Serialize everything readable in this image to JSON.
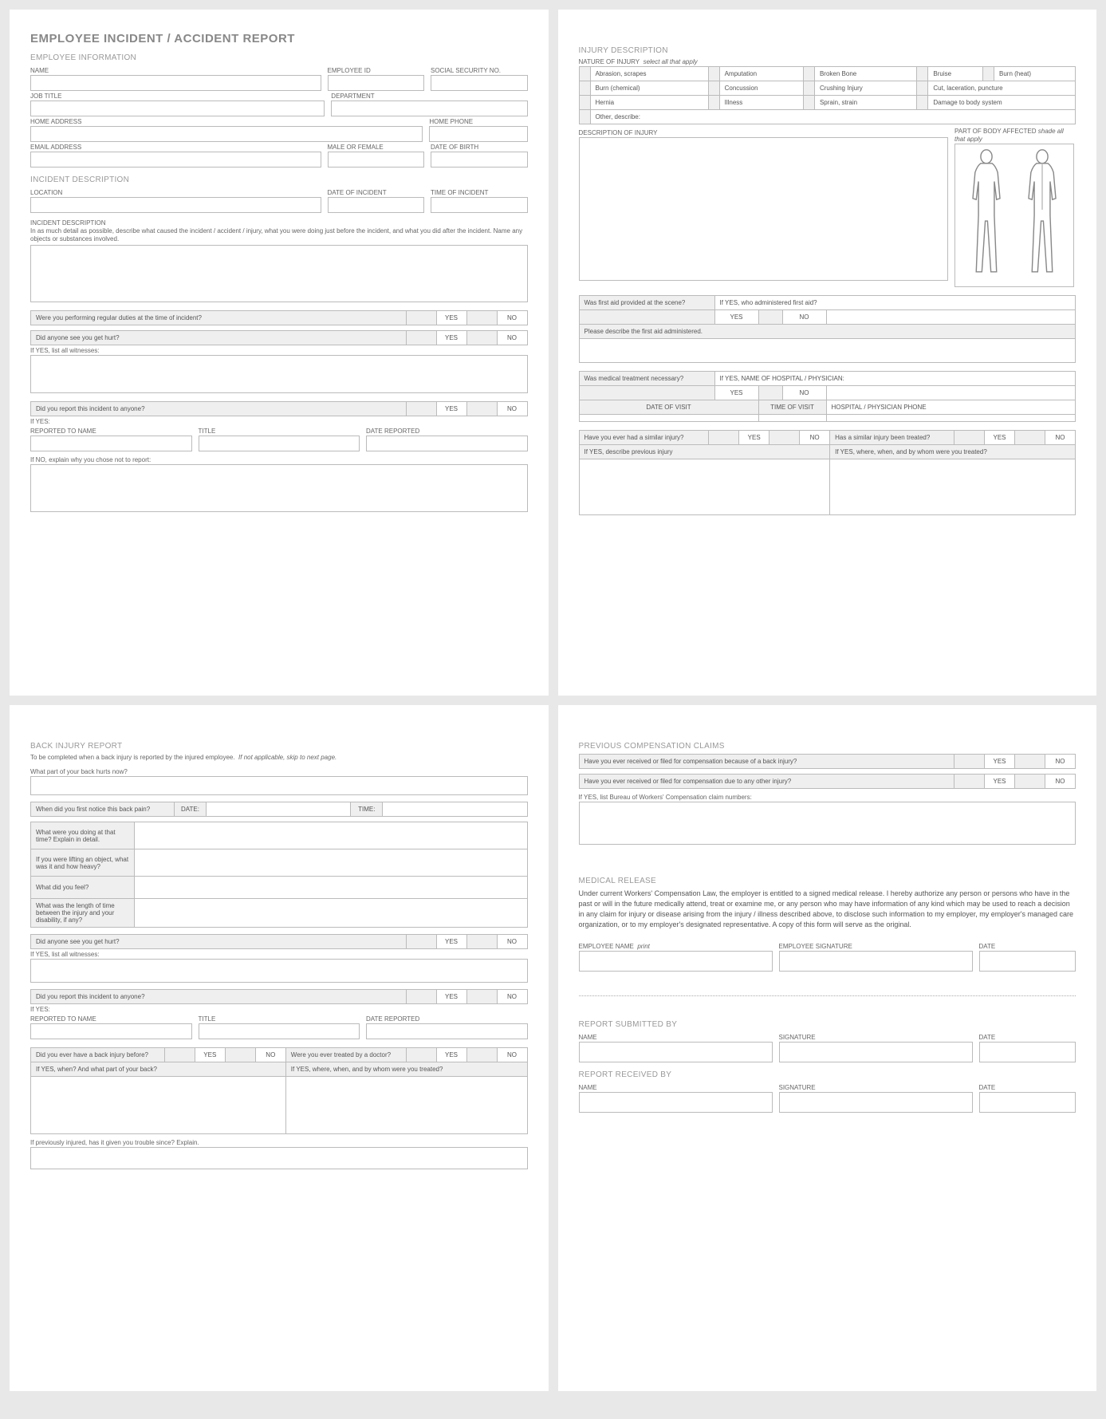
{
  "title": "EMPLOYEE INCIDENT / ACCIDENT REPORT",
  "p1": {
    "h_emp": "EMPLOYEE INFORMATION",
    "name": "NAME",
    "empid": "EMPLOYEE ID",
    "ssn": "SOCIAL SECURITY NO.",
    "job": "JOB TITLE",
    "dept": "DEPARTMENT",
    "home_addr": "HOME ADDRESS",
    "home_phone": "HOME PHONE",
    "email": "EMAIL ADDRESS",
    "mf": "MALE OR FEMALE",
    "dob": "DATE OF BIRTH",
    "h_inc": "INCIDENT DESCRIPTION",
    "loc": "LOCATION",
    "doi": "DATE OF INCIDENT",
    "toi": "TIME OF INCIDENT",
    "inc_desc_lbl": "INCIDENT DESCRIPTION",
    "inc_desc_txt": "In as much detail as possible, describe what caused the incident / accident / injury, what you were doing just before the incident, and what you did after the incident.  Name any objects or substances involved.",
    "q_duties": "Were you performing regular duties at the time of incident?",
    "q_seen": "Did anyone see you get hurt?",
    "witness": "If YES, list all witnesses:",
    "q_report": "Did you report this incident to anyone?",
    "if_yes": "If YES:",
    "rep_name": "REPORTED TO NAME",
    "rep_title": "TITLE",
    "rep_date": "DATE REPORTED",
    "if_no": "If NO, explain why you chose not to report:",
    "yes": "YES",
    "no": "NO"
  },
  "p2": {
    "h_inj": "INJURY DESCRIPTION",
    "nature_lbl": "NATURE OF INJURY",
    "nature_note": "select all that apply",
    "r1": [
      "Abrasion, scrapes",
      "Amputation",
      "Broken Bone",
      "Bruise",
      "Burn (heat)"
    ],
    "r2": [
      "Burn (chemical)",
      "Concussion",
      "Crushing Injury",
      "Cut, laceration, puncture"
    ],
    "r3": [
      "Hernia",
      "Illness",
      "Sprain, strain",
      "Damage to body system"
    ],
    "r4": "Other, describe:",
    "desc_inj": "DESCRIPTION OF INJURY",
    "body_aff": "PART OF BODY AFFECTED",
    "shade": "shade all that apply",
    "q_fa": "Was first aid provided at the scene?",
    "fa_who": "If YES, who administered first aid?",
    "fa_desc": "Please describe the first aid administered.",
    "q_med": "Was medical treatment necessary?",
    "med_name": "If YES, NAME OF HOSPITAL / PHYSICIAN:",
    "dov": "DATE OF VISIT",
    "tov": "TIME OF VISIT",
    "hp_phone": "HOSPITAL / PHYSICIAN PHONE",
    "q_sim": "Have you ever had a similar injury?",
    "q_sim_tr": "Has a similar injury been treated?",
    "sim_prev": "If YES, describe previous injury",
    "sim_where": "If YES, where, when, and by whom were you treated?",
    "yes": "YES",
    "no": "NO"
  },
  "p3": {
    "h_back": "BACK INJURY REPORT",
    "sub": "To be completed when a back injury is reported by the injured employee.",
    "sub_it": "If not applicable, skip to next page.",
    "q_part": "What part of your back hurts now?",
    "q_notice": "When did you first notice this back pain?",
    "date": "DATE:",
    "time": "TIME:",
    "q_doing": "What were you doing at that time?  Explain in detail.",
    "q_lift": "If you were lifting an object, what was it and how heavy?",
    "q_feel": "What did you feel?",
    "q_len": "What was the length of time between the injury and your disability, if any?",
    "q_seen": "Did anyone see you get hurt?",
    "witness": "If YES, list all witnesses:",
    "q_report": "Did you report this incident to anyone?",
    "if_yes": "If YES:",
    "rep_name": "REPORTED TO NAME",
    "rep_title": "TITLE",
    "rep_date": "DATE REPORTED",
    "q_prev_back": "Did you ever have a back injury before?",
    "q_prev_dr": "Were you ever treated by a doctor?",
    "prev_when": "If YES, when? And what part of your back?",
    "prev_where": "If YES, where, when, and by whom were you treated?",
    "prev_trouble": "If previously injured, has it given you trouble since?  Explain.",
    "yes": "YES",
    "no": "NO"
  },
  "p4": {
    "h_prev": "PREVIOUS COMPENSATION CLAIMS",
    "q_comp_back": "Have you ever received or filed for compensation because of a back injury?",
    "q_comp_other": "Have you ever received or filed for compensation due to any other injury?",
    "bureau": "If YES, list Bureau of Workers' Compensation claim numbers:",
    "h_med": "MEDICAL RELEASE",
    "med_txt": "Under current Workers' Compensation Law, the employer is entitled to a signed medical release.  I hereby authorize any person or persons who have in the past or will in the future medically attend, treat or examine me, or any person who may have information of any kind which may be used to reach a decision in any claim for injury or disease arising from the injury / illness described above, to disclose such information to my employer, my employer's managed care organization, or to my employer's designated representative.  A copy of this form will serve as the original.",
    "emp_name": "EMPLOYEE NAME",
    "print": "print",
    "emp_sig": "EMPLOYEE SIGNATURE",
    "date": "DATE",
    "h_sub": "REPORT SUBMITTED BY",
    "h_rec": "REPORT RECEIVED BY",
    "name": "NAME",
    "sig": "SIGNATURE",
    "yes": "YES",
    "no": "NO"
  }
}
